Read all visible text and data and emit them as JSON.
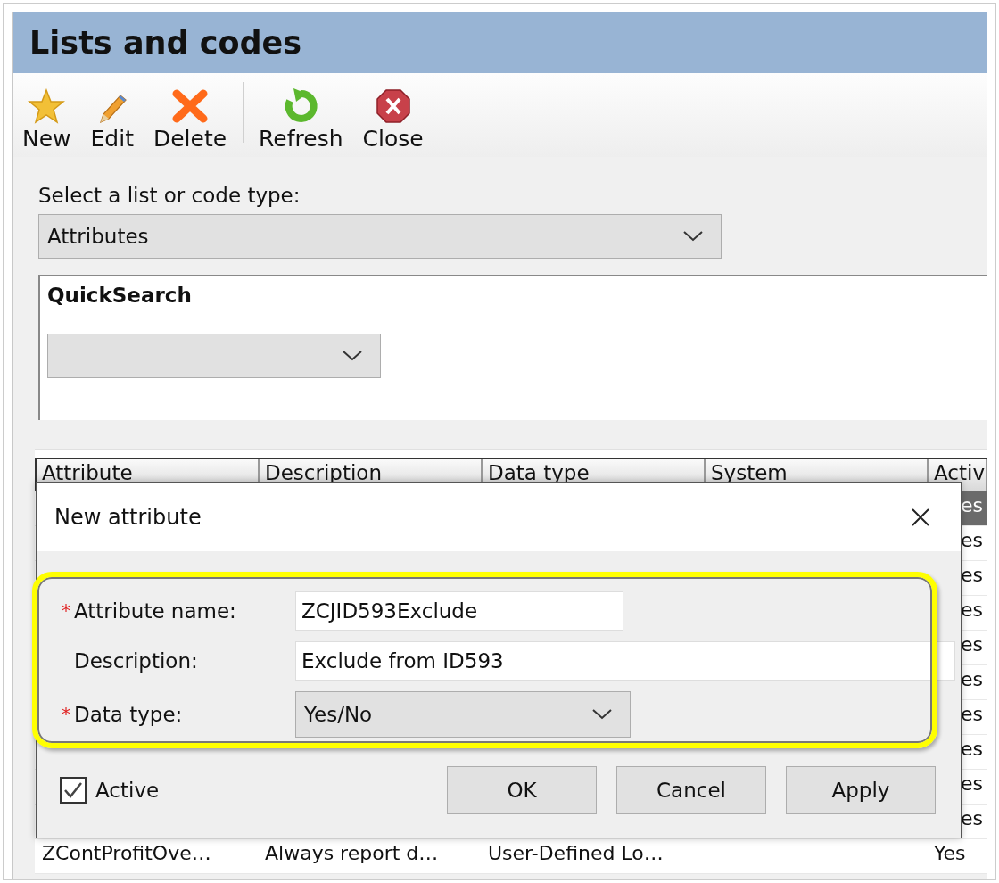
{
  "title": "Lists and codes",
  "toolbar": {
    "groups": [
      [
        {
          "kind": "star",
          "label": "New"
        },
        {
          "kind": "pencil",
          "label": "Edit"
        },
        {
          "kind": "cross",
          "label": "Delete"
        }
      ],
      [
        {
          "kind": "refresh",
          "label": "Refresh"
        },
        {
          "kind": "close",
          "label": "Close"
        }
      ]
    ]
  },
  "selector": {
    "label": "Select a list or code type:",
    "value": "Attributes"
  },
  "quicksearch": {
    "title": "QuickSearch"
  },
  "table": {
    "columns": [
      "Attribute",
      "Description",
      "Data type",
      "System",
      "Activ"
    ],
    "rows": [
      {
        "selected": true,
        "cells": [
          null,
          null,
          null,
          null,
          "es"
        ]
      },
      {
        "selected": false,
        "cells": [
          null,
          null,
          null,
          null,
          "es"
        ]
      },
      {
        "selected": false,
        "cells": [
          null,
          null,
          null,
          null,
          "es"
        ]
      },
      {
        "selected": false,
        "cells": [
          null,
          null,
          null,
          null,
          "es"
        ]
      },
      {
        "selected": false,
        "cells": [
          null,
          null,
          null,
          null,
          "es"
        ]
      },
      {
        "selected": false,
        "cells": [
          null,
          null,
          null,
          null,
          "es"
        ]
      },
      {
        "selected": false,
        "cells": [
          null,
          null,
          null,
          null,
          "es"
        ]
      },
      {
        "selected": false,
        "cells": [
          null,
          null,
          null,
          null,
          "es"
        ]
      },
      {
        "selected": false,
        "cells": [
          null,
          null,
          null,
          null,
          "es"
        ]
      },
      {
        "selected": false,
        "cells": [
          null,
          null,
          null,
          null,
          "es"
        ]
      },
      {
        "selected": false,
        "cells": [
          "ZContProfitOve…",
          "Always report d…",
          "User-Defined Lo…",
          null,
          "Yes"
        ]
      }
    ]
  },
  "dialog": {
    "title": "New attribute",
    "fields": [
      {
        "mark": "*",
        "label": "Attribute name:",
        "kind": "text",
        "value": "ZCJID593Exclude"
      },
      {
        "label": "Description:",
        "kind": "wide_text",
        "value": "Exclude from ID593"
      },
      {
        "mark": "*",
        "label": "Data type:",
        "kind": "select",
        "value": "Yes/No"
      }
    ],
    "active": {
      "label": "Active",
      "checked": true
    },
    "buttons": [
      "OK",
      "Cancel",
      "Apply"
    ]
  }
}
